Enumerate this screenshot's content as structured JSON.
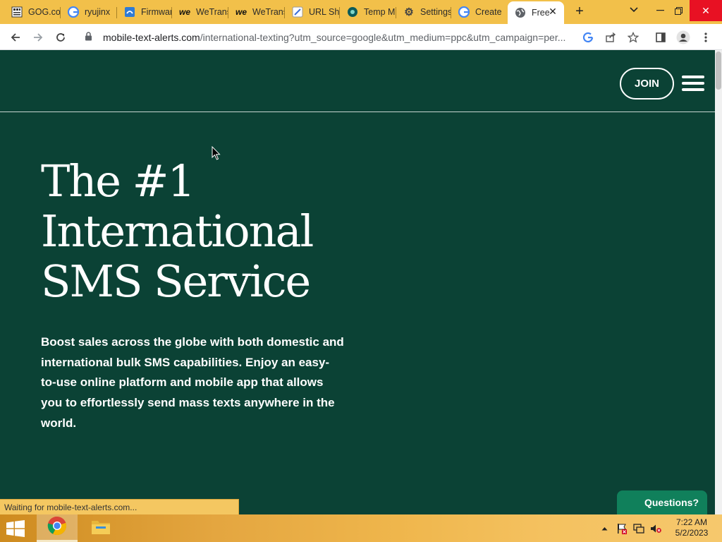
{
  "browser": {
    "tabs": [
      {
        "label": "GOG.com",
        "icon": "gog-icon"
      },
      {
        "label": "ryujinx",
        "icon": "google-icon"
      },
      {
        "label": "Firmware",
        "icon": "firmware-icon"
      },
      {
        "label": "WeTransfer",
        "icon": "wetransfer-icon"
      },
      {
        "label": "WeTransfer",
        "icon": "wetransfer-icon"
      },
      {
        "label": "URL Shortener",
        "icon": "url-shortener-icon"
      },
      {
        "label": "Temp Mail",
        "icon": "temp-mail-icon"
      },
      {
        "label": "Settings",
        "icon": "gear-icon"
      },
      {
        "label": "Create",
        "icon": "google-icon"
      },
      {
        "label": "Free",
        "icon": "globe-icon",
        "active": true
      }
    ],
    "address": {
      "host": "mobile-text-alerts.com",
      "path": "/international-texting?utm_source=google&utm_medium=ppc&utm_campaign=per..."
    }
  },
  "site": {
    "join_label": "JOIN",
    "hero_title_lines": [
      "The #1",
      "International",
      "SMS Service"
    ],
    "hero_text": "Boost sales across the globe with both domestic and international bulk SMS capabilities. Enjoy an easy-to-use online platform and mobile app that allows you to effortlessly send mass texts anywhere in the world.",
    "questions_label": "Questions?"
  },
  "status": {
    "text": "Waiting for mobile-text-alerts.com..."
  },
  "taskbar": {
    "time": "7:22 AM",
    "date": "5/2/2023"
  },
  "colors": {
    "page_bg": "#0b4235",
    "questions_bg": "#10805b",
    "tabstrip_bg": "#f2c04a"
  }
}
